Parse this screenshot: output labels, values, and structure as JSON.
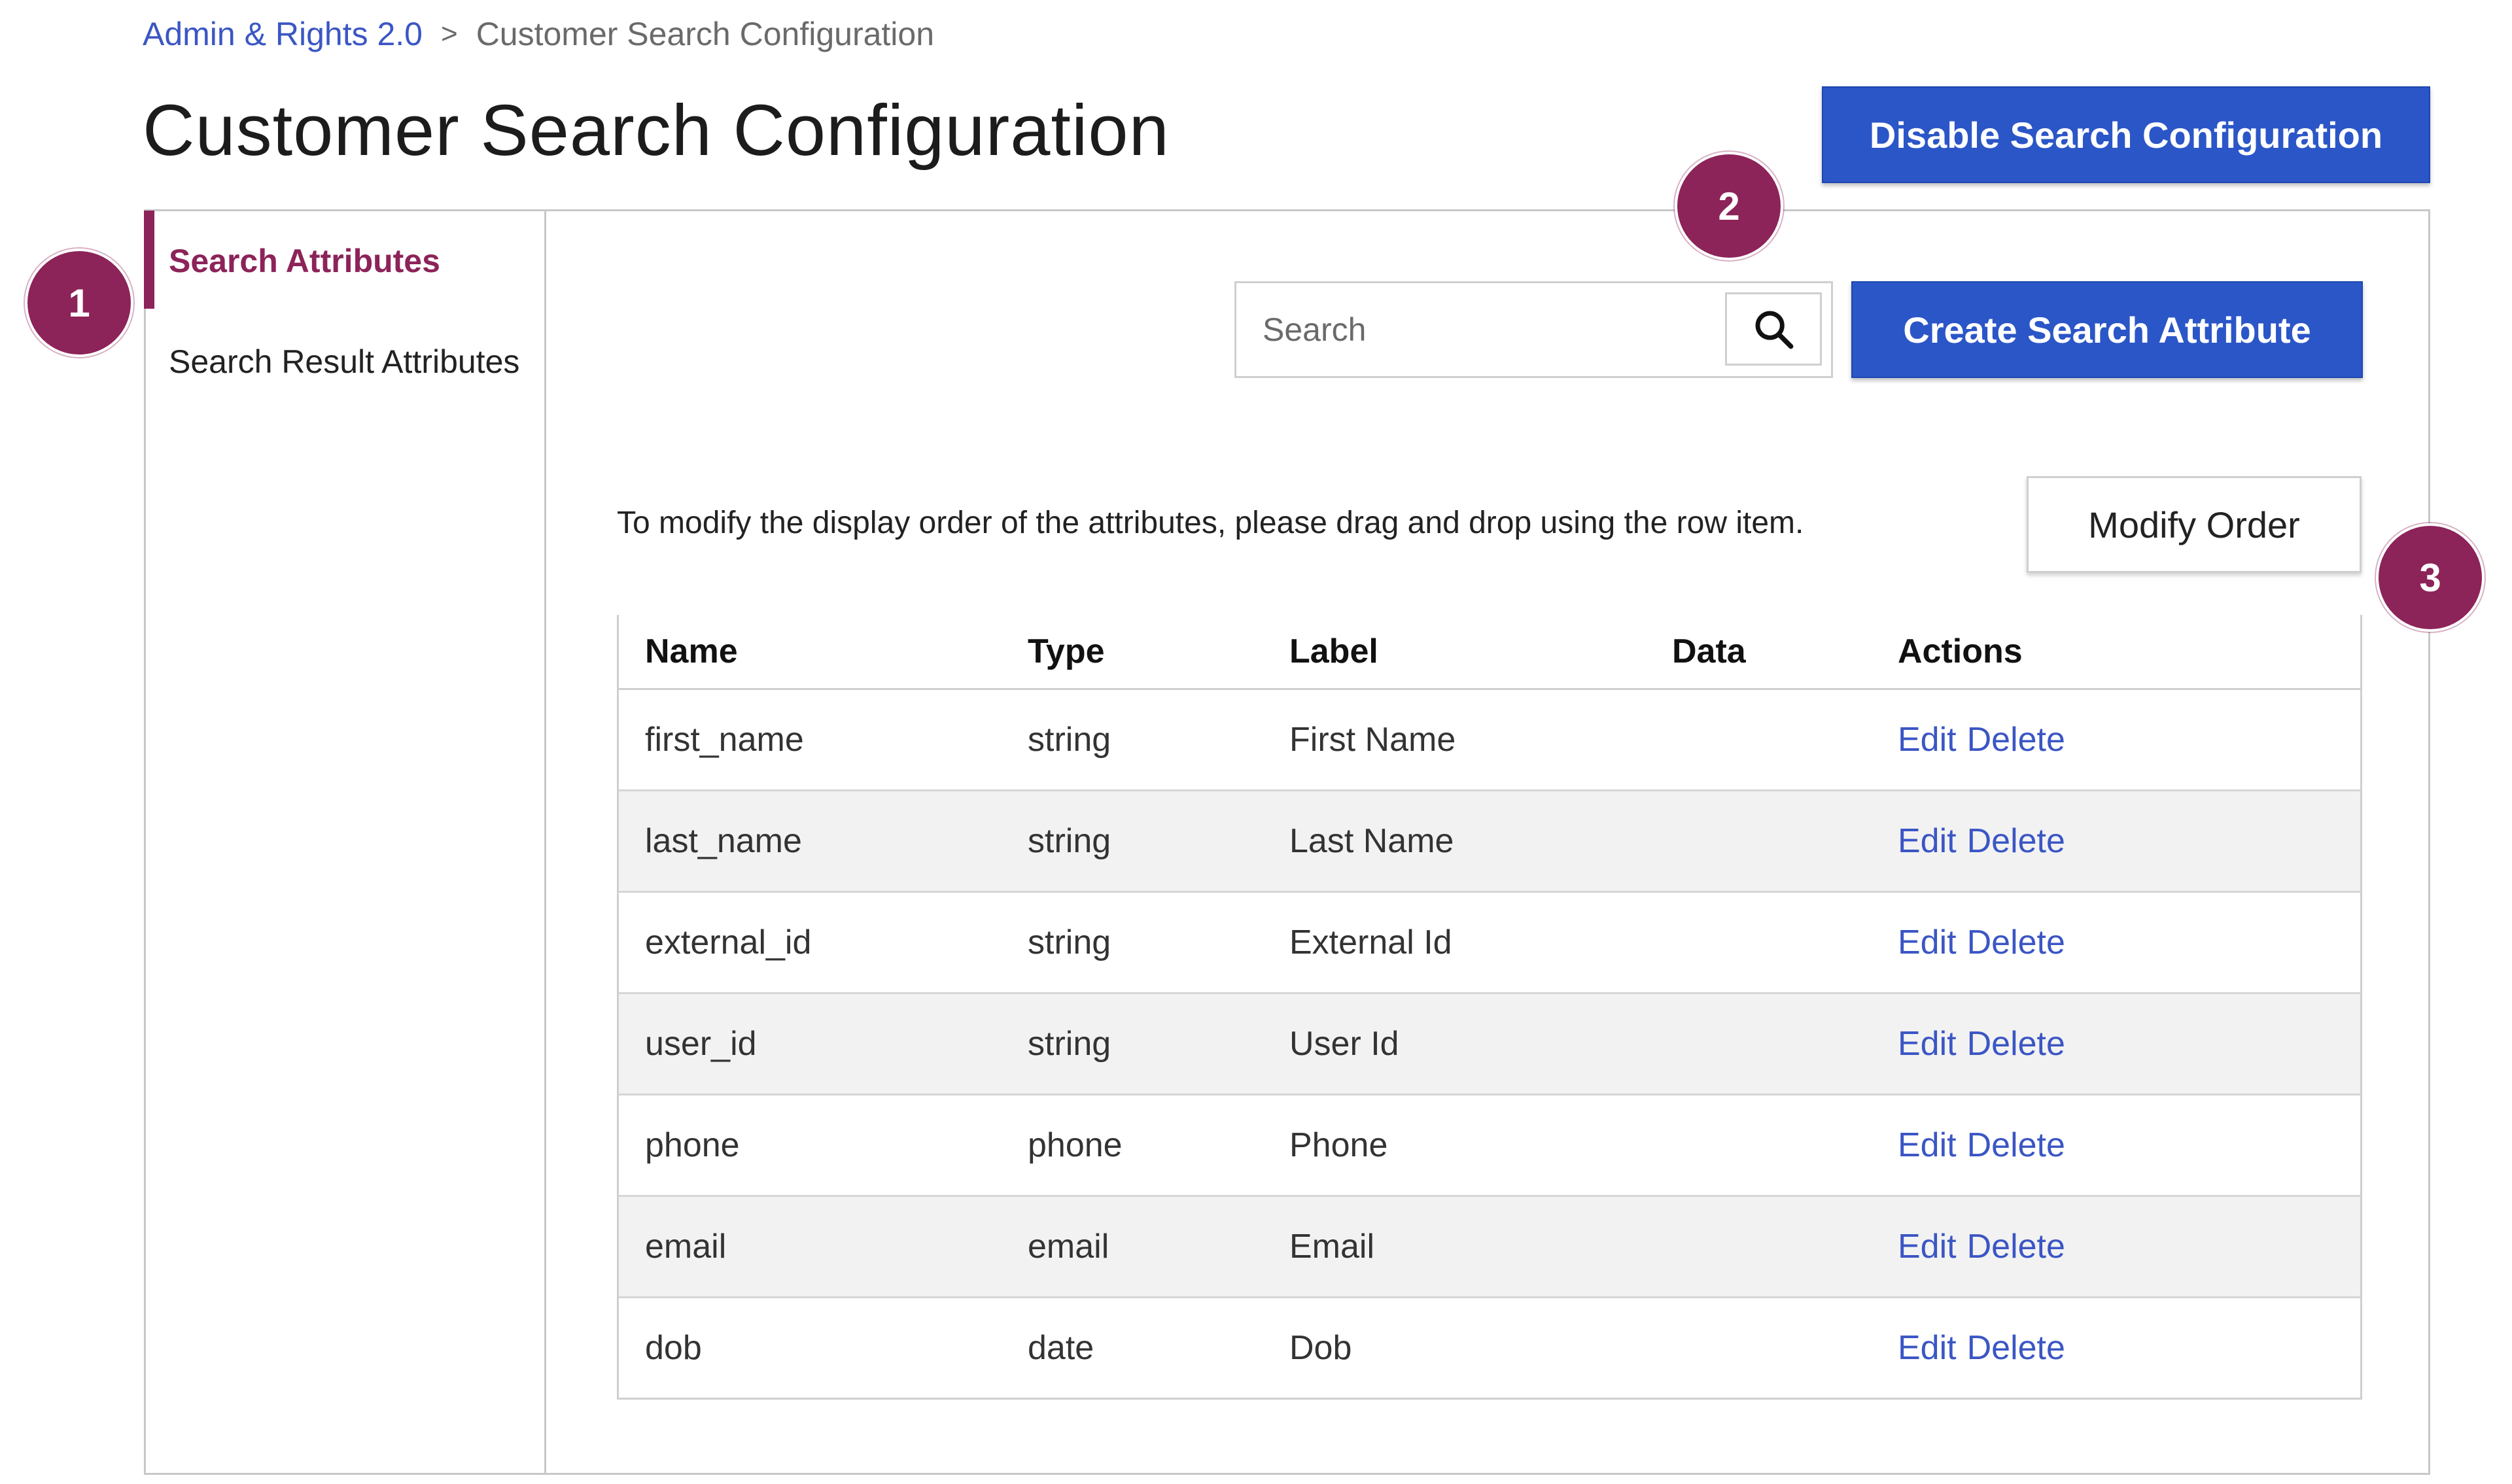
{
  "breadcrumb": {
    "root": "Admin & Rights 2.0",
    "separator": ">",
    "current": "Customer Search Configuration"
  },
  "page": {
    "title": "Customer Search Configuration"
  },
  "header": {
    "disable_button_label": "Disable Search Configuration"
  },
  "sidebar": {
    "items": [
      {
        "label": "Search Attributes",
        "active": true
      },
      {
        "label": "Search Result Attributes",
        "active": false
      }
    ]
  },
  "search": {
    "placeholder": "Search",
    "value": "",
    "icon": "search-icon"
  },
  "toolbar": {
    "create_button_label": "Create Search Attribute"
  },
  "instructions": {
    "text": "To modify the display order of the attributes, please drag and drop using the row item.",
    "modify_order_label": "Modify Order"
  },
  "table": {
    "columns": [
      "Name",
      "Type",
      "Label",
      "Data",
      "Actions"
    ],
    "edit_label": "Edit",
    "delete_label": "Delete",
    "rows": [
      {
        "name": "first_name",
        "type": "string",
        "label": "First Name",
        "data": ""
      },
      {
        "name": "last_name",
        "type": "string",
        "label": "Last Name",
        "data": ""
      },
      {
        "name": "external_id",
        "type": "string",
        "label": "External Id",
        "data": ""
      },
      {
        "name": "user_id",
        "type": "string",
        "label": "User Id",
        "data": ""
      },
      {
        "name": "phone",
        "type": "phone",
        "label": "Phone",
        "data": ""
      },
      {
        "name": "email",
        "type": "email",
        "label": "Email",
        "data": ""
      },
      {
        "name": "dob",
        "type": "date",
        "label": "Dob",
        "data": ""
      }
    ]
  },
  "annotations": {
    "badge_1": "1",
    "badge_2": "2",
    "badge_3": "3"
  },
  "colors": {
    "accent": "#8c2359",
    "primary_button": "#2b56c7",
    "link": "#3b56c4",
    "zebra_row": "#f2f2f2"
  }
}
